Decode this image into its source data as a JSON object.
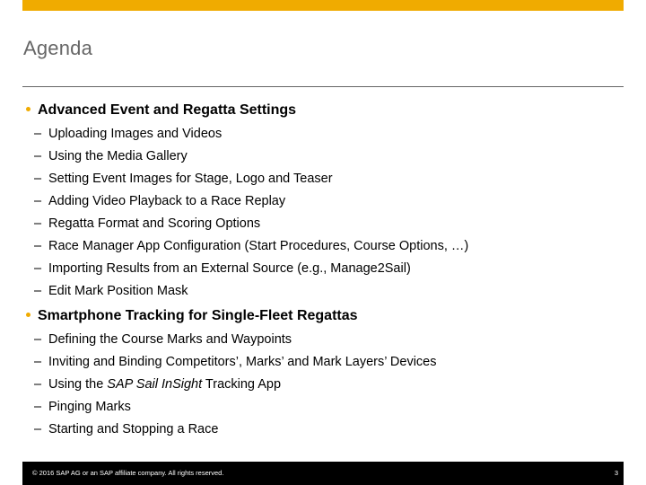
{
  "slide": {
    "title": "Agenda",
    "accent_color": "#f0ab00"
  },
  "sections": [
    {
      "label": "Advanced Event and Regatta Settings",
      "items": [
        {
          "dash": "–",
          "text": "Uploading Images and Videos"
        },
        {
          "dash": "–",
          "text": "Using the Media Gallery"
        },
        {
          "dash": "–",
          "text": "Setting Event Images for Stage, Logo and Teaser"
        },
        {
          "dash": "–",
          "text": "Adding Video Playback to a Race Replay"
        },
        {
          "dash": "–",
          "text": "Regatta Format and Scoring Options"
        },
        {
          "dash": "–",
          "text": "Race Manager App Configuration (Start Procedures, Course Options, …)"
        },
        {
          "dash": "–",
          "text": "Importing Results from an External Source (e.g., Manage2Sail)"
        },
        {
          "dash": "–",
          "text": "Edit Mark Position Mask"
        }
      ]
    },
    {
      "label": "Smartphone Tracking for Single-Fleet Regattas",
      "items": [
        {
          "dash": "–",
          "text": "Defining the Course Marks and Waypoints"
        },
        {
          "dash": "–",
          "text": "Inviting and Binding Competitors’, Marks’ and Mark Layers’ Devices"
        },
        {
          "dash": "–",
          "text_before": "Using the ",
          "text_italic": "SAP Sail InSight",
          "text_after": " Tracking App"
        },
        {
          "dash": "–",
          "text": "Pinging Marks"
        },
        {
          "dash": "–",
          "text": "Starting and Stopping a Race"
        }
      ]
    }
  ],
  "footer": {
    "copyright": "© 2016 SAP AG or an SAP affiliate company. All rights reserved.",
    "page_number": "3"
  }
}
